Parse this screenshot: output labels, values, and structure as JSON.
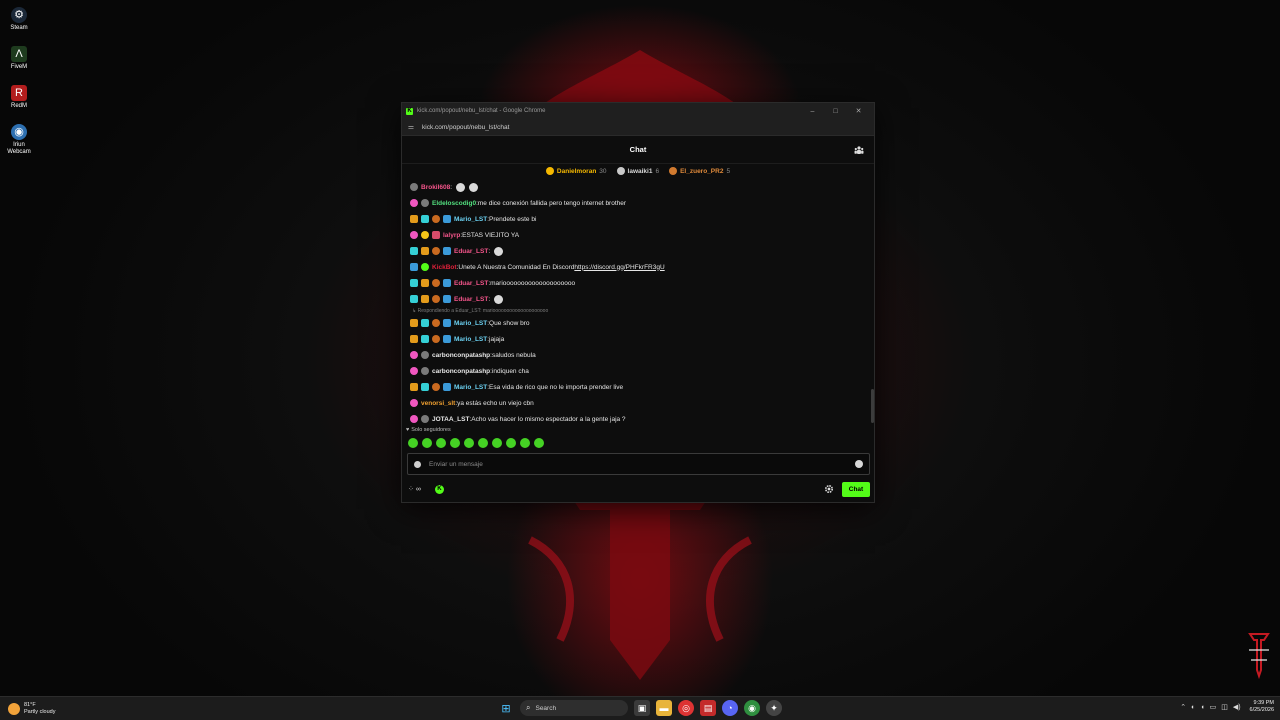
{
  "desktop": {
    "icons": [
      {
        "label": "Steam",
        "color": "#1b2838"
      },
      {
        "label": "FiveM",
        "color": "#2a6a2a"
      },
      {
        "label": "RedM",
        "color": "#b31d1d"
      },
      {
        "label": "Iriun Webcam",
        "color": "#2d6fb0"
      }
    ]
  },
  "window": {
    "title": "kick.com/popout/nebu_lst/chat - Google Chrome",
    "url": "kick.com/popout/nebu_lst/chat",
    "min": "–",
    "max": "□",
    "close": "✕"
  },
  "chat": {
    "title": "Chat",
    "leaderboard": [
      {
        "name": "Danielmoran",
        "count": "30",
        "color": "#f5b800",
        "medal": "#f5b800"
      },
      {
        "name": "lawaiki1",
        "count": "6",
        "color": "#d9d9d9",
        "medal": "#c9c9c9"
      },
      {
        "name": "El_zuero_PR2",
        "count": "5",
        "color": "#e08a3a",
        "medal": "#d17a2f"
      }
    ],
    "messages": [
      {
        "badges": [
          "emote"
        ],
        "user": "Brokil608",
        "color": "#f5558b",
        "text": "",
        "emotes": 2
      },
      {
        "badges": [
          "pink",
          "emote"
        ],
        "user": "Eldeloscodig0",
        "color": "#53e07f",
        "text": "me dice conexión fallida pero tengo internet brother"
      },
      {
        "badges": [
          "sub",
          "mod",
          "og",
          "ver"
        ],
        "user": "Mario_LST",
        "color": "#6bd0f0",
        "text": "Prendete este bi"
      },
      {
        "badges": [
          "pink",
          "yel",
          "gift"
        ],
        "user": "lalyrp",
        "color": "#f5558b",
        "text": "ESTAS VIEJITO YA"
      },
      {
        "badges": [
          "mod",
          "sub",
          "og",
          "ver"
        ],
        "user": "Eduar_LST",
        "color": "#f5558b",
        "text": "",
        "emotes": 1
      },
      {
        "badges": [
          "bot",
          "check"
        ],
        "user": "KickBot",
        "color": "#e1213a",
        "text": "Unete A Nuestra Comunidad En Discord ",
        "link": "https://discord.gg/PHFkrFR3gU"
      },
      {
        "badges": [
          "mod",
          "sub",
          "og",
          "ver"
        ],
        "user": "Eduar_LST",
        "color": "#f5558b",
        "text": "marioooooooooooooooooooo"
      },
      {
        "badges": [
          "mod",
          "sub",
          "og",
          "ver"
        ],
        "user": "Eduar_LST",
        "color": "#f5558b",
        "text": "",
        "emotes": 1
      }
    ],
    "reply_ref": "↳ Respondiendo a Eduar_LST: marioooooooooooooooooooo",
    "messages2": [
      {
        "badges": [
          "sub",
          "mod",
          "og",
          "ver"
        ],
        "user": "Mario_LST",
        "color": "#6bd0f0",
        "text": "Que show bro"
      },
      {
        "badges": [
          "sub",
          "mod",
          "og",
          "ver"
        ],
        "user": "Mario_LST",
        "color": "#6bd0f0",
        "text": "jajaja"
      },
      {
        "badges": [
          "pink",
          "emote"
        ],
        "user": "carbonconpatashp",
        "color": "#e6e6e6",
        "text": "saludos nebula"
      },
      {
        "badges": [
          "pink",
          "emote"
        ],
        "user": "carbonconpatashp",
        "color": "#e6e6e6",
        "text": "indiquen cha"
      },
      {
        "badges": [
          "sub",
          "mod",
          "og",
          "ver"
        ],
        "user": "Mario_LST",
        "color": "#6bd0f0",
        "text": "Esa vida de rico que no le importa prender live"
      },
      {
        "badges": [
          "pink"
        ],
        "user": "venorsi_slt",
        "color": "#f0a030",
        "text": "ya estás echo un viejo cbn"
      },
      {
        "badges": [
          "pink",
          "emote"
        ],
        "user": "JOTAA_LST",
        "color": "#e6e6e6",
        "text": "Acho vas hacer lo mismo espectador a la gente jaja ?"
      }
    ],
    "followers_only": "Solo seguidores",
    "input_placeholder": "Enviar un mensaje",
    "points": "∞",
    "send_label": "Chat"
  },
  "taskbar": {
    "weather_temp": "81°F",
    "weather_desc": "Partly cloudy",
    "search_label": "Search",
    "time": "9:39 PM",
    "date": "6/25/2026"
  }
}
